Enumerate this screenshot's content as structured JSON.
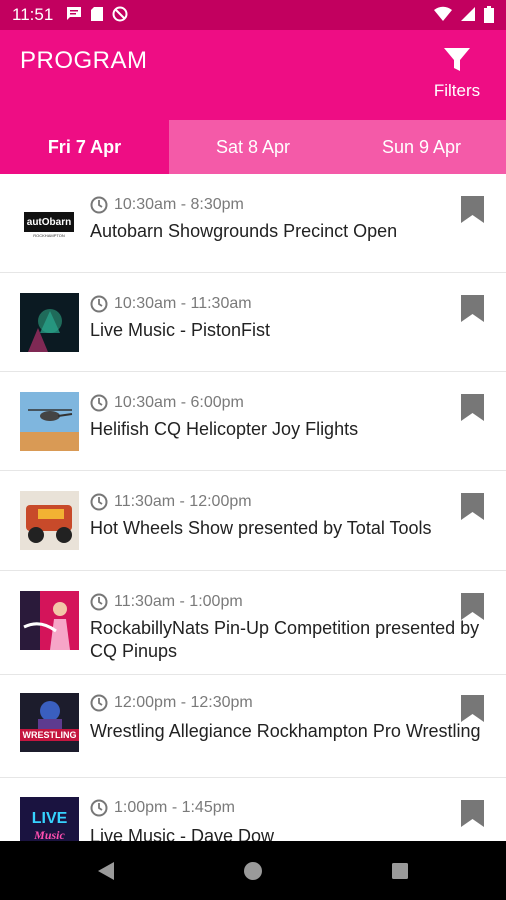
{
  "status": {
    "time": "11:51"
  },
  "app": {
    "title": "PROGRAM",
    "filters_label": "Filters"
  },
  "tabs": [
    {
      "label": "Fri 7 Apr",
      "active": true
    },
    {
      "label": "Sat 8 Apr",
      "active": false
    },
    {
      "label": "Sun 9 Apr",
      "active": false
    }
  ],
  "events": [
    {
      "time": "10:30am - 8:30pm",
      "title": "Autobarn Showgrounds Precinct Open",
      "logo_text": "autObarn",
      "logo_sub": "ROCKHAMPTON"
    },
    {
      "time": "10:30am - 11:30am",
      "title": "Live Music - PistonFist"
    },
    {
      "time": "10:30am - 6:00pm",
      "title": "Helifish CQ Helicopter Joy Flights"
    },
    {
      "time": "11:30am - 12:00pm",
      "title": "Hot Wheels Show presented by Total Tools"
    },
    {
      "time": "11:30am - 1:00pm",
      "title": "RockabillyNats Pin-Up Competition presented by CQ Pinups"
    },
    {
      "time": "12:00pm - 12:30pm",
      "title": "Wrestling Allegiance Rockhampton Pro Wrestling",
      "logo_text": "WRESTLING"
    },
    {
      "time": "1:00pm - 1:45pm",
      "title": "Live Music - Dave Dow",
      "logo_text": "LIVE",
      "logo_sub": "Music"
    }
  ],
  "colors": {
    "primary": "#ee0d84",
    "status_bar": "#c2005f",
    "tab_inactive": "#f45aa8"
  }
}
